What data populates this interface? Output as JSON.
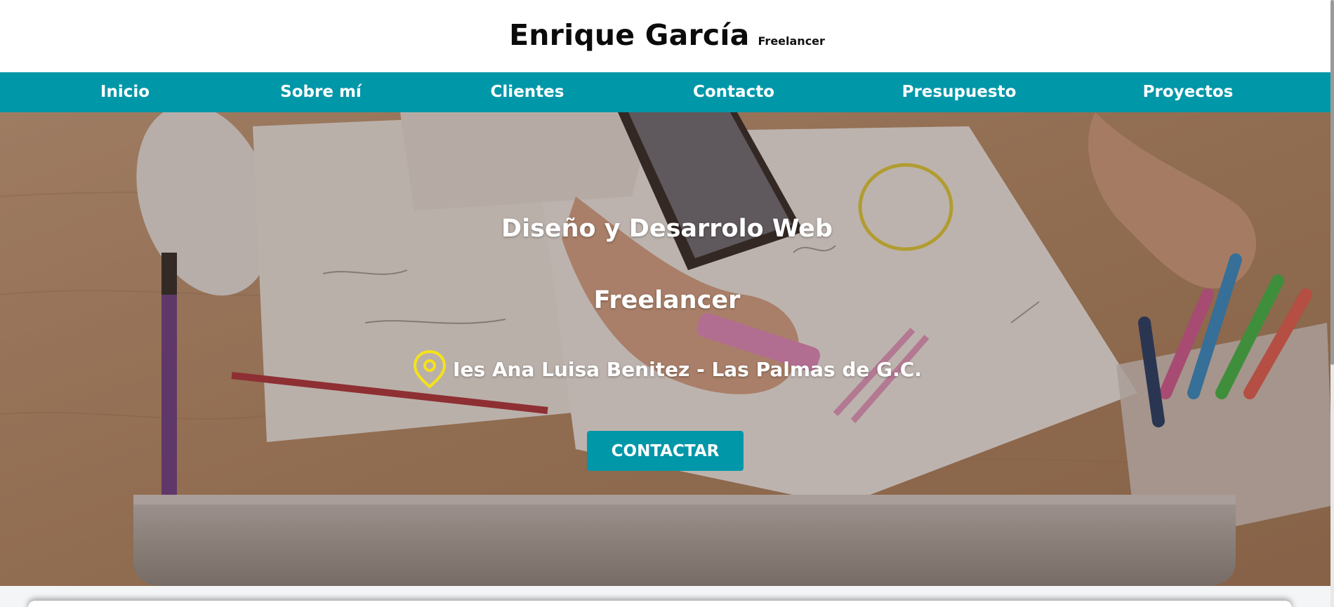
{
  "header": {
    "name": "Enrique García",
    "tagline": "Freelancer"
  },
  "nav": {
    "items": [
      {
        "label": "Inicio"
      },
      {
        "label": "Sobre mí"
      },
      {
        "label": "Clientes"
      },
      {
        "label": "Contacto"
      },
      {
        "label": "Presupuesto"
      },
      {
        "label": "Proyectos"
      }
    ]
  },
  "hero": {
    "title": "Diseño y Desarrolo Web",
    "subtitle": "Freelancer",
    "location": "Ies Ana Luisa Benitez - Las Palmas de G.C.",
    "location_icon": "map-pin-icon",
    "cta_label": "CONTACTAR"
  },
  "colors": {
    "accent": "#0097a8",
    "pin": "#f5e21a",
    "text_light": "#ffffff",
    "text_dark": "#0b0b0b"
  }
}
